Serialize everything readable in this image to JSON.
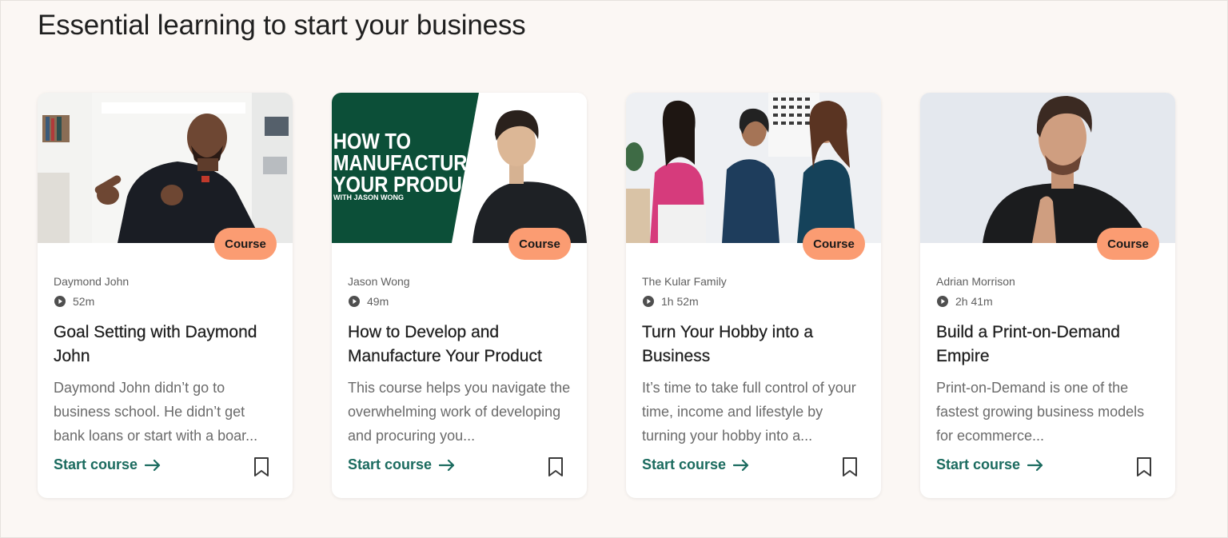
{
  "section": {
    "title": "Essential learning to start your business"
  },
  "colors": {
    "page_bg": "#fbf7f4",
    "badge_bg": "#fb9c72",
    "link": "#1b6b5f",
    "thumb2_green": "#0c4f38"
  },
  "cards": [
    {
      "thumbnail_text": [],
      "badge": "Course",
      "author": "Daymond John",
      "duration": "52m",
      "title": "Goal Setting with Daymond John",
      "description": "Daymond John didn’t go to business school. He didn’t get bank loans or start with a boar...",
      "cta": "Start course",
      "icons": [
        "play-icon",
        "arrow-right-icon",
        "bookmark-icon"
      ]
    },
    {
      "thumbnail_text": [
        "HOW TO",
        "MANUFACTURE",
        "YOUR PRODUCT",
        "WITH JASON WONG"
      ],
      "badge": "Course",
      "author": "Jason Wong",
      "duration": "49m",
      "title": "How to Develop and Manufacture Your Product",
      "description": "This course helps you navigate the overwhelming work of developing and procuring you...",
      "cta": "Start course",
      "icons": [
        "play-icon",
        "arrow-right-icon",
        "bookmark-icon"
      ]
    },
    {
      "thumbnail_text": [],
      "badge": "Course",
      "author": "The Kular Family",
      "duration": "1h 52m",
      "title": "Turn Your Hobby into a Business",
      "description": "It’s time to take full control of your time, income and lifestyle by turning your hobby into a...",
      "cta": "Start course",
      "icons": [
        "play-icon",
        "arrow-right-icon",
        "bookmark-icon"
      ]
    },
    {
      "thumbnail_text": [],
      "badge": "Course",
      "author": "Adrian Morrison",
      "duration": "2h 41m",
      "title": "Build a Print-on-Demand Empire",
      "description": "Print-on-Demand is one of the fastest growing business models for ecommerce...",
      "cta": "Start course",
      "icons": [
        "play-icon",
        "arrow-right-icon",
        "bookmark-icon"
      ]
    }
  ]
}
